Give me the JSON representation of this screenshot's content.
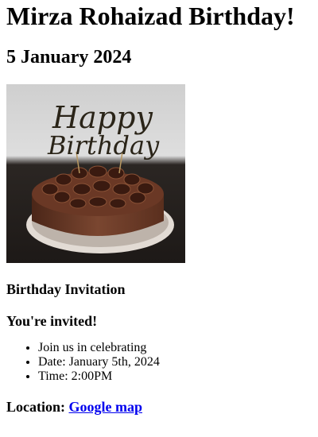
{
  "header": {
    "title": "Mirza Rohaizad Birthday!",
    "date": "5 January 2024"
  },
  "image": {
    "caption_text_line1": "Happy",
    "caption_text_line2": "Birthday",
    "subject": "chocolate-birthday-cake",
    "colors": {
      "background_top": "#d7d7d7",
      "table": "#2a2522",
      "cake": "#6b3a26",
      "plate": "#ddd6cf"
    }
  },
  "invitation": {
    "heading": "Birthday Invitation",
    "subheading": "You're invited!",
    "details": [
      "Join us in celebrating",
      "Date: January 5th, 2024",
      "Time: 2:00PM"
    ],
    "location_label": "Location:",
    "location_link": "Google map"
  }
}
